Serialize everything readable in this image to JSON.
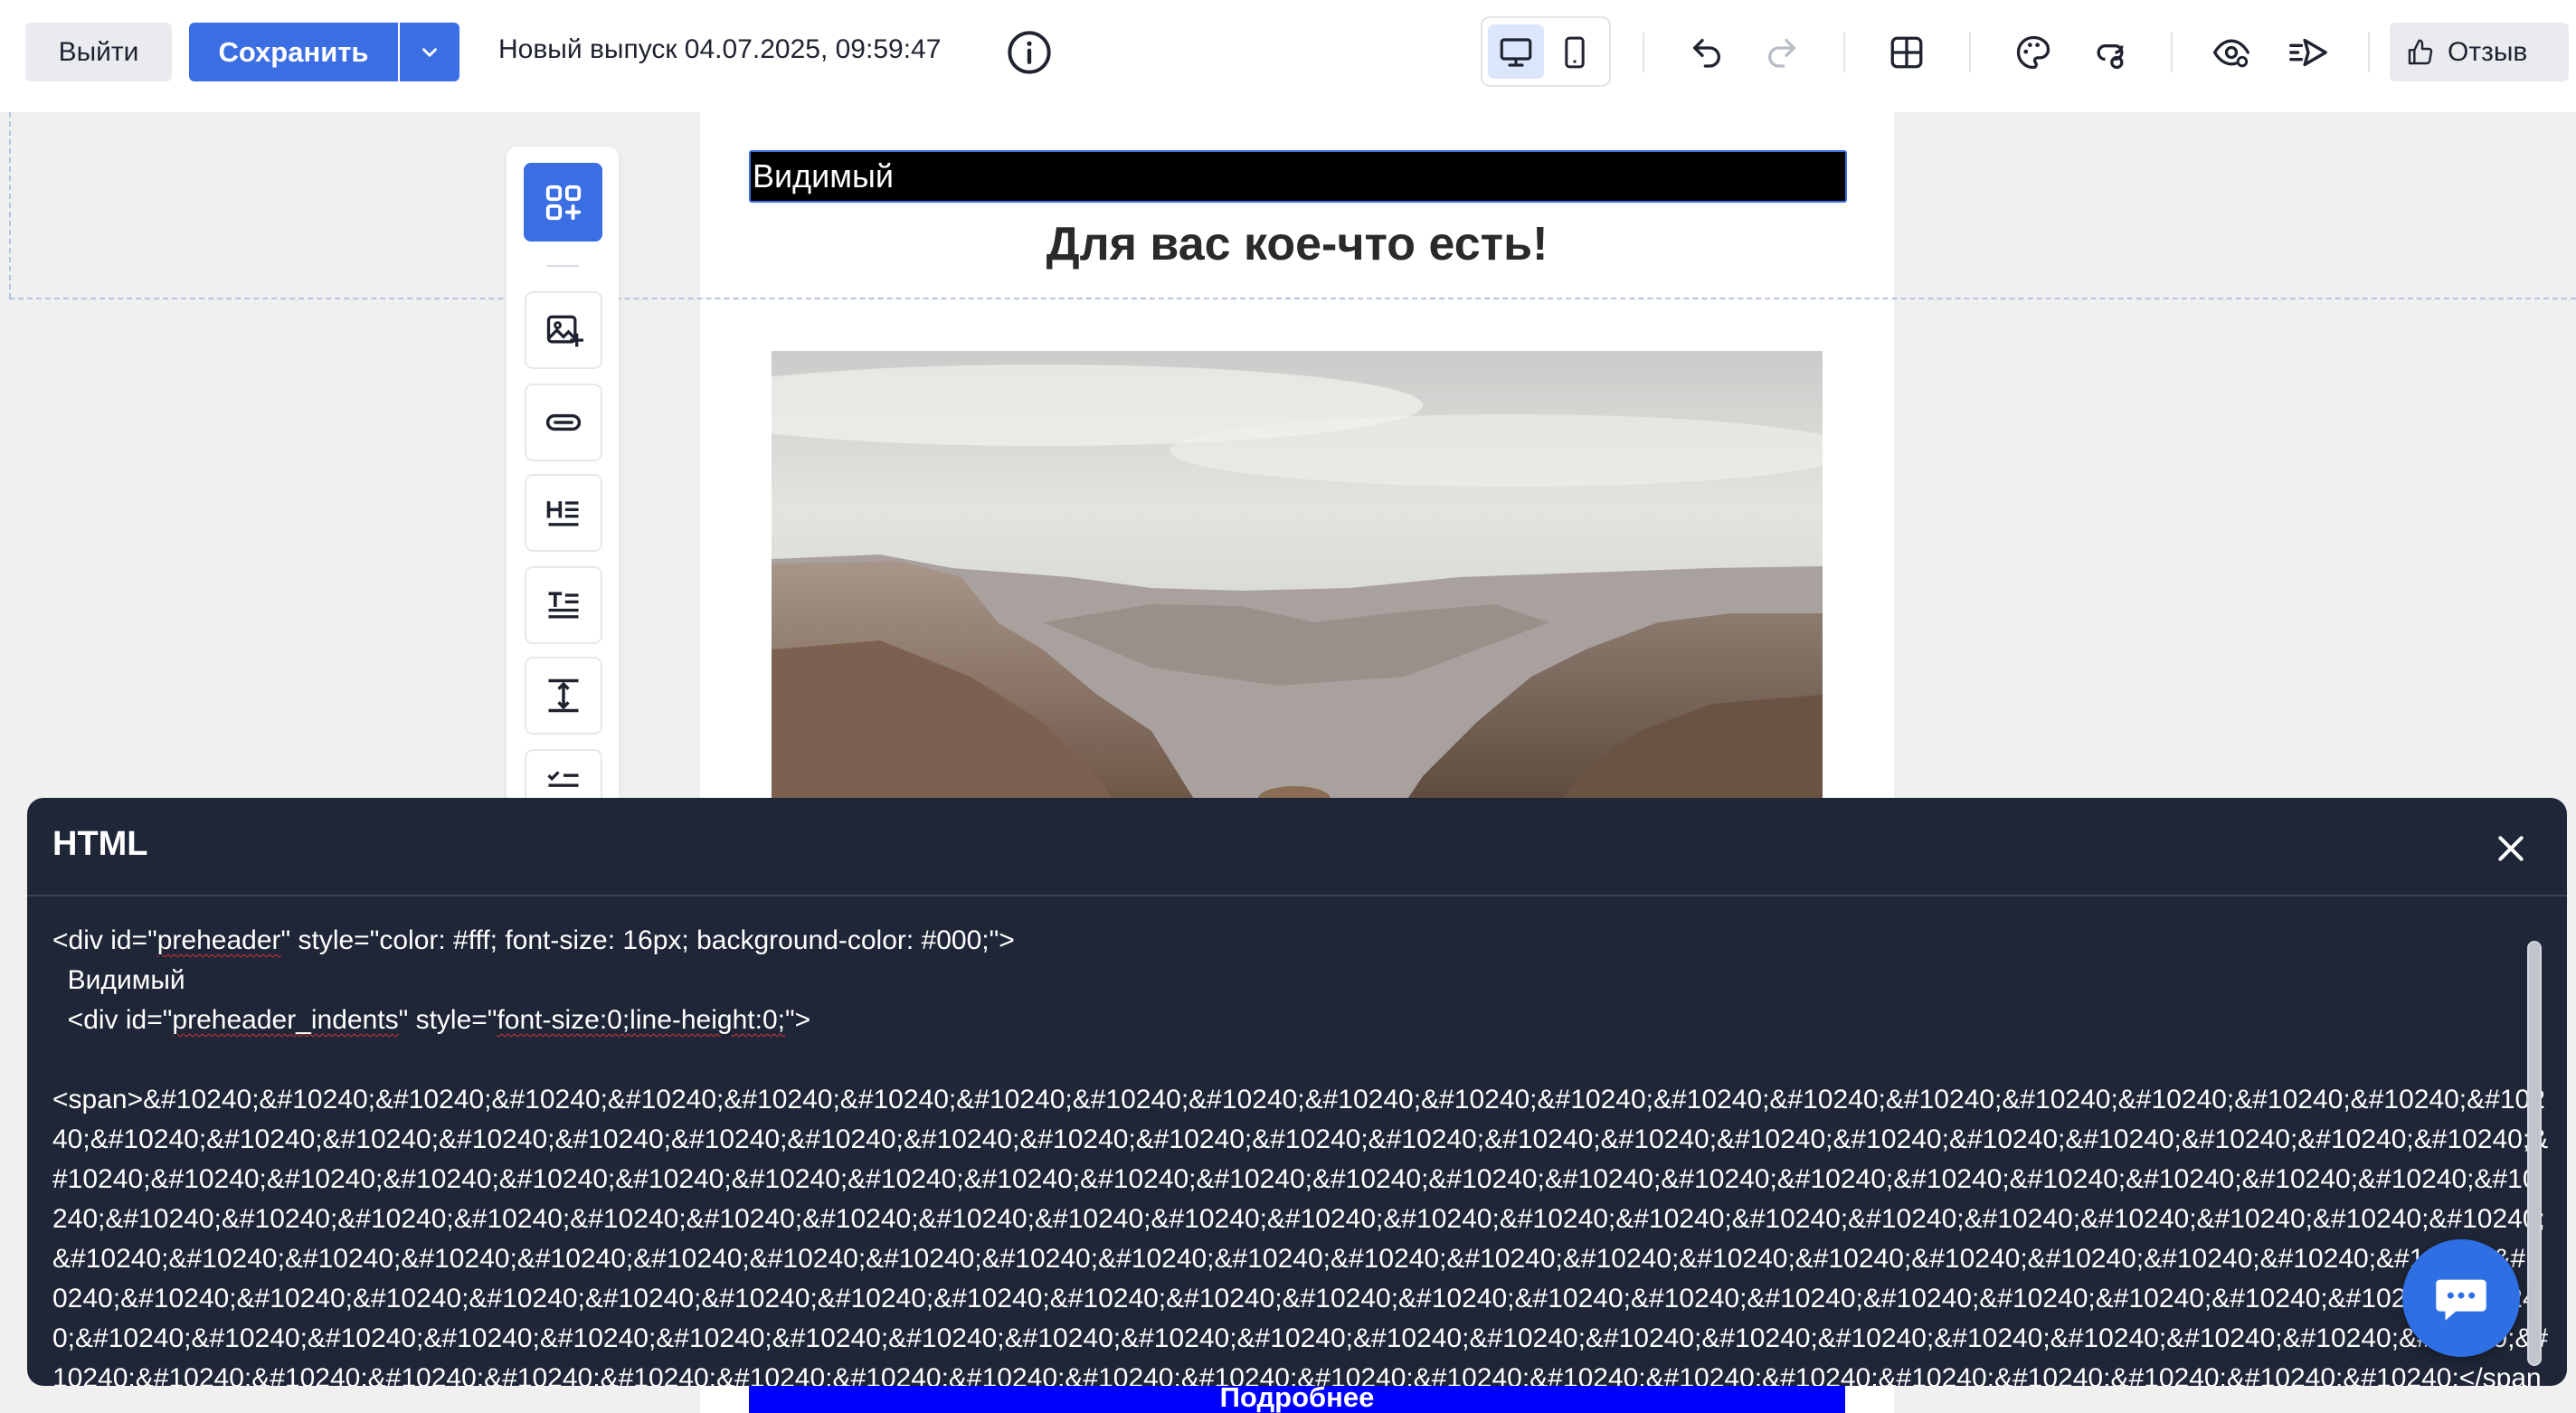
{
  "toolbar": {
    "exit_label": "Выйти",
    "save_label": "Сохранить",
    "issue_title": "Новый выпуск 04.07.2025, 09:59:47",
    "review_label": "Отзыв",
    "accent": "#3c6ee3",
    "icons": [
      "info-icon",
      "desktop-icon",
      "mobile-icon",
      "undo-icon",
      "redo-icon",
      "layout-grid-icon",
      "palette-icon",
      "link-settings-icon",
      "preview-eye-icon",
      "send-test-icon",
      "thumbs-up-icon"
    ]
  },
  "email": {
    "preheader_text": "Видимый",
    "headline": "Для вас кое-что есть!",
    "cta_label": "Подробнее",
    "cta_color": "#0000ff"
  },
  "palette": {
    "icons": [
      "add-block-icon",
      "image-block-icon",
      "button-block-icon",
      "heading-block-icon",
      "text-block-icon",
      "spacer-block-icon",
      "list-block-icon"
    ]
  },
  "html_panel": {
    "title": "HTML",
    "code_line1_a": "<div id=\"",
    "code_line1_b": "preheader",
    "code_line1_c": "\" style=\"color: #fff; font-size: 16px; background-color: #000;\">",
    "code_line2": "  Видимый",
    "code_line3_a": "  <div id=\"",
    "code_line3_b": "preheader_indents",
    "code_line3_c": "\" style=\"",
    "code_line3_d": "font-size:0;line-height:0;",
    "code_line3_e": "\">",
    "span_open": "<span>",
    "entity": "&#10240;",
    "span_close": "</span>",
    "entity_count_visible": 170
  }
}
